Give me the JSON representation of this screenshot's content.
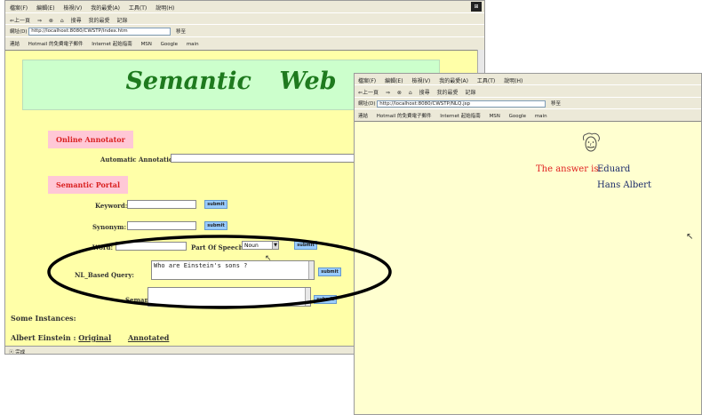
{
  "back_window": {
    "menu": [
      "檔案(F)",
      "編輯(E)",
      "檢視(V)",
      "我的最愛(A)",
      "工具(T)",
      "說明(H)"
    ],
    "toolbar": [
      "⇐上一頁",
      "⇒",
      "⊗",
      "⌂",
      "搜尋",
      "我的最愛",
      "記錄"
    ],
    "address_label": "網址(D)",
    "address_value": "http://localhost:8080/CWSTP/index.htm",
    "go_label": "移至",
    "links_label": "連結",
    "links": [
      "Hotmail 的免費電子郵件",
      "Internet 起始指南",
      "MSN",
      "Google",
      "main"
    ],
    "banner_title": "Semantic Web",
    "online_annotator_label": "Online Annotator",
    "automatic_annotation_label": "Automatic Annotation:",
    "semantic_portal_label": "Semantic Portal",
    "keyword_label": "Keyword:",
    "synonym_label": "Synonym:",
    "word_label": "Word:",
    "part_of_speech_label": "Part Of Speech:",
    "part_of_speech_value": "Noun",
    "nl_query_label": "NL_Based Query:",
    "nl_query_value": "Who are Einstein's sons ?",
    "semantic_label": "Semantic",
    "submit_label": "submit",
    "some_instances_label": "Some Instances:",
    "albert_prefix": "Albert Einstein : ",
    "original_link": "Original",
    "annotated_link": "Annotated",
    "status_text": "完成"
  },
  "front_window": {
    "menu": [
      "檔案(F)",
      "編輯(E)",
      "檢視(V)",
      "我的最愛(A)",
      "工具(T)",
      "說明(H)"
    ],
    "toolbar": [
      "⇐上一頁",
      "⇒",
      "⊗",
      "⌂",
      "搜尋",
      "我的最愛",
      "記錄"
    ],
    "address_label": "網址(D)",
    "address_value": "http://localhost:8080/CWSTP/NLQ.jsp",
    "go_label": "移至",
    "links_label": "連結",
    "links": [
      "Hotmail 的免費電子郵件",
      "Internet 起始指南",
      "MSN",
      "Google",
      "main"
    ],
    "answer_label": "The answer is:",
    "answers": [
      "Eduard",
      "Hans Albert"
    ]
  },
  "colors": {
    "page_yellow": "#ffffa8",
    "banner_green": "#ccffcc",
    "title_green": "#1e7a1e",
    "section_pink": "#ffc8d6",
    "section_red": "#d92020",
    "submit_blue": "#99ccff",
    "answer_red": "#e02020"
  }
}
